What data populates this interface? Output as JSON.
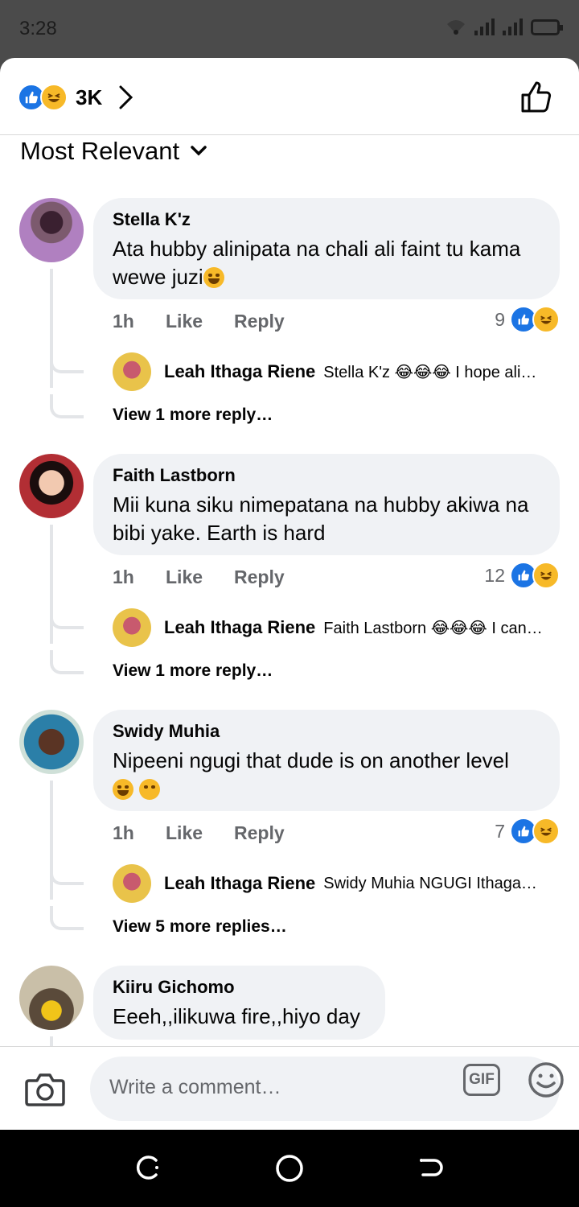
{
  "status_bar": {
    "time": "3:28"
  },
  "reactions": {
    "count": "3K"
  },
  "sort": {
    "label": "Most Relevant"
  },
  "comments": [
    {
      "author": "Stella K'z",
      "text": "Ata hubby alinipata na chali ali faint tu kama wewe juzi",
      "time": "1h",
      "like": "Like",
      "reply": "Reply",
      "reaction_count": "9",
      "reply_preview": {
        "author": "Leah Ithaga Riene",
        "text": "Stella K'z 😂😂😂 I hope ali…"
      },
      "more_replies": "View 1 more reply…"
    },
    {
      "author": "Faith Lastborn",
      "text": "Mii kuna siku nimepatana na hubby akiwa na bibi yake. Earth is hard",
      "time": "1h",
      "like": "Like",
      "reply": "Reply",
      "reaction_count": "12",
      "reply_preview": {
        "author": "Leah Ithaga Riene",
        "text": "Faith Lastborn 😂😂😂 I can…"
      },
      "more_replies": "View 1 more reply…"
    },
    {
      "author": "Swidy Muhia",
      "text": "Nipeeni ngugi that dude is on another level",
      "time": "1h",
      "like": "Like",
      "reply": "Reply",
      "reaction_count": "7",
      "reply_preview": {
        "author": "Leah Ithaga Riene",
        "text": "Swidy Muhia NGUGI Ithaga…"
      },
      "more_replies": "View 5 more replies…"
    },
    {
      "author": "Kiiru Gichomo",
      "text": "Eeeh,,ilikuwa fire,,hiyo day"
    }
  ],
  "composer": {
    "placeholder": "Write a comment…",
    "gif_label": "GIF"
  },
  "colors": {
    "like_blue": "#1b74e4",
    "haha_yellow": "#f7b928",
    "bubble_bg": "#f0f2f5",
    "meta_gray": "#65676b"
  }
}
